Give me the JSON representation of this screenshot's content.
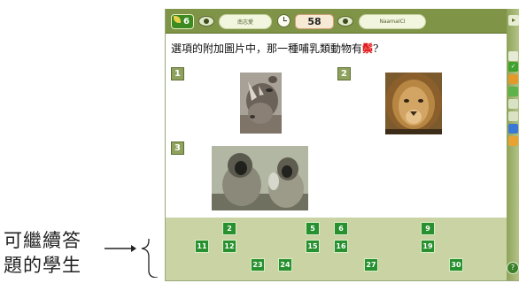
{
  "annotation": {
    "line1": "可繼續答",
    "line2": "題的學生"
  },
  "topbar": {
    "level": "6",
    "player_label": "南志愛",
    "timer": "58",
    "school_label": "NaamaICI"
  },
  "question": {
    "before": "選項的附加圖片中，那一種哺乳類動物有",
    "highlight": "鬃",
    "after": "?"
  },
  "options": [
    {
      "label": "1",
      "subject": "rhinoceros"
    },
    {
      "label": "2",
      "subject": "lion"
    },
    {
      "label": "3",
      "subject": "monkeys"
    }
  ],
  "students": {
    "row1": [
      "2",
      "5",
      "6",
      "9"
    ],
    "row2": [
      "11",
      "12",
      "15",
      "16",
      "19"
    ],
    "row3": [
      "23",
      "24",
      "27",
      "30"
    ]
  },
  "colors": {
    "toolbar": "#7f9447",
    "student_chip": "#27902f",
    "highlight": "#e21c1c",
    "panel": "#c9d3a3"
  },
  "icons": [
    "leaf-icon",
    "eye-icon",
    "clock-icon",
    "arrow-icon",
    "help-icon"
  ]
}
